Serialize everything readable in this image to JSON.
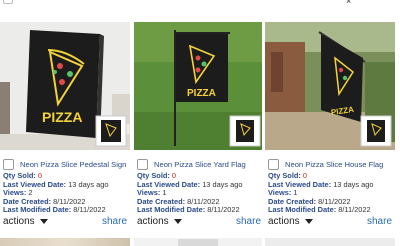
{
  "products": [
    {
      "title": "Neon Pizza Slice Pedestal Sign",
      "qty_sold_label": "Qty Sold:",
      "qty_sold": "0",
      "last_viewed_label": "Last Viewed Date:",
      "last_viewed": "13 days ago",
      "views_label": "Views:",
      "views": "2",
      "date_created_label": "Date Created:",
      "date_created": "8/11/2022",
      "last_modified_label": "Last Modified Date:",
      "last_modified": "8/11/2022",
      "actions_label": "actions",
      "share_label": "share",
      "image_text": "PIZZA"
    },
    {
      "title": "Neon Pizza Slice Yard Flag",
      "qty_sold_label": "Qty Sold:",
      "qty_sold": "0",
      "last_viewed_label": "Last Viewed Date:",
      "last_viewed": "13 days ago",
      "views_label": "Views:",
      "views": "1",
      "date_created_label": "Date Created:",
      "date_created": "8/11/2022",
      "last_modified_label": "Last Modified Date:",
      "last_modified": "8/11/2022",
      "actions_label": "actions",
      "share_label": "share",
      "image_text": "PIZZA"
    },
    {
      "title": "Neon Pizza Slice House Flag",
      "qty_sold_label": "Qty Sold:",
      "qty_sold": "0",
      "last_viewed_label": "Last Viewed Date:",
      "last_viewed": "13 days ago",
      "views_label": "Views:",
      "views": "1",
      "date_created_label": "Date Created:",
      "date_created": "8/11/2022",
      "last_modified_label": "Last Modified Date:",
      "last_modified": "8/11/2022",
      "actions_label": "actions",
      "share_label": "share",
      "image_text": "PIZZA"
    }
  ],
  "top_close_glyph": "×",
  "colors": {
    "link": "#2b4a8b",
    "share": "#2b6cb0",
    "zero": "#e01f1f",
    "neon_yellow": "#f3d23a",
    "sign_black": "#1c1c1c"
  }
}
